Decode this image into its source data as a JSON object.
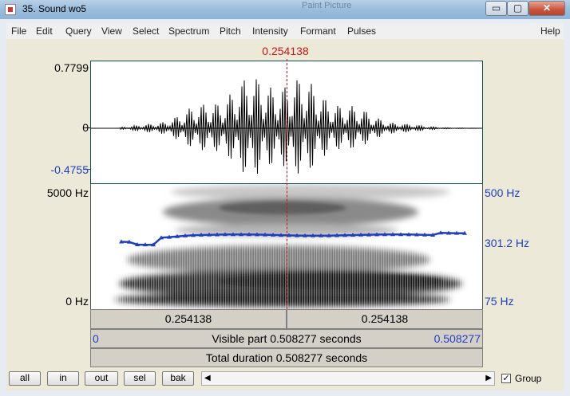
{
  "window": {
    "title": "35. Sound wo5",
    "background_window_title": "Paint Picture",
    "min_glyph": "▭",
    "max_glyph": "▢",
    "close_glyph": "✕"
  },
  "menu": [
    "File",
    "Edit",
    "Query",
    "View",
    "Select",
    "Spectrum",
    "Pitch",
    "Intensity",
    "Formant",
    "Pulses",
    "Help"
  ],
  "cursor_time": "0.254138",
  "waveform": {
    "max_label": "0.7799",
    "zero_label": "0",
    "min_label": "-0.4755"
  },
  "spectrogram": {
    "top_label": "5000 Hz",
    "bottom_label": "0 Hz",
    "pitch_top_label": "500 Hz",
    "pitch_value_label": "301.2 Hz",
    "pitch_bottom_label": "75 Hz"
  },
  "time_bars": {
    "left_segment": "0.254138",
    "right_segment": "0.254138",
    "visible_start": "0",
    "visible_text": "Visible part 0.508277 seconds",
    "visible_end": "0.508277",
    "total_text": "Total duration 0.508277 seconds"
  },
  "toolbar": {
    "buttons": [
      "all",
      "in",
      "out",
      "sel",
      "bak"
    ],
    "group_label": "Group",
    "group_checked": true
  },
  "colors": {
    "cursor": "#c81414",
    "pitch": "#1f3fbf",
    "waveform": "#000000"
  }
}
